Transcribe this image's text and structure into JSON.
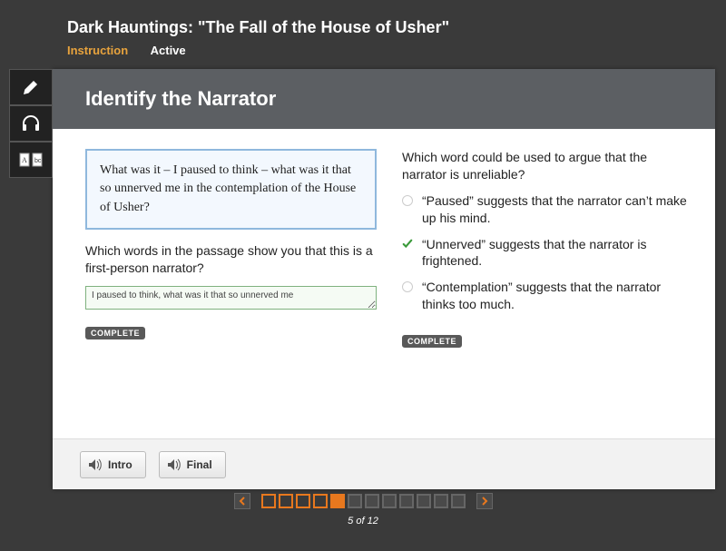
{
  "header": {
    "title": "Dark Hauntings: \"The Fall of the House of Usher\"",
    "tab_instruction": "Instruction",
    "tab_active": "Active"
  },
  "panel": {
    "title": "Identify the Narrator"
  },
  "left": {
    "passage": "What was it – I paused to think – what was it that so unnerved me in the contemplation of the House of Usher?",
    "question": "Which words in the passage show you that this is a first-person narrator?",
    "answer": "I paused to think, what was it that so unnerved me",
    "complete": "COMPLETE"
  },
  "right": {
    "question": "Which word could be used to argue that the narrator is unreliable?",
    "options": [
      {
        "text": "“Paused” suggests that the narrator can’t make up his mind.",
        "selected": false
      },
      {
        "text": "“Unnerved” suggests that the narrator is frightened.",
        "selected": true
      },
      {
        "text": "“Contemplation” suggests that the narrator thinks too much.",
        "selected": false
      }
    ],
    "complete": "COMPLETE"
  },
  "footer": {
    "intro": "Intro",
    "final": "Final"
  },
  "nav": {
    "current": 5,
    "total": 12,
    "label": "5 of 12"
  }
}
